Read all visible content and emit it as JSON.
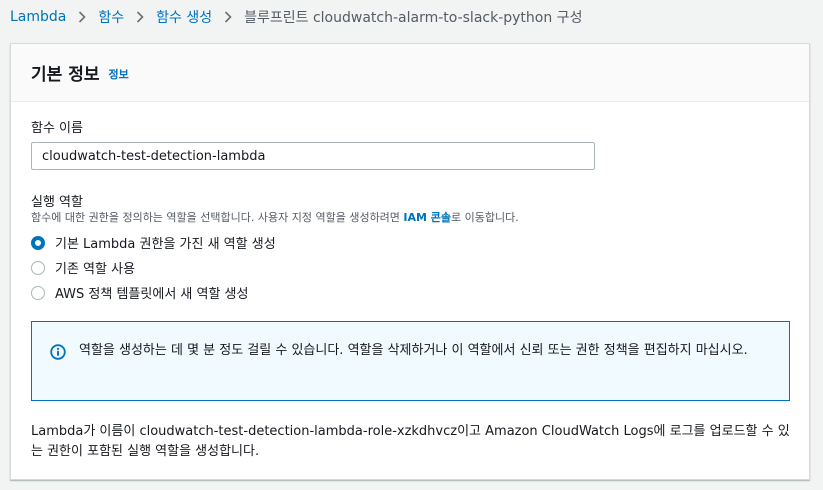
{
  "breadcrumb": {
    "items": [
      "Lambda",
      "함수",
      "함수 생성"
    ],
    "current": "블루프린트 cloudwatch-alarm-to-slack-python 구성"
  },
  "panel": {
    "title": "기본 정보",
    "info_link": "정보"
  },
  "function_name": {
    "label": "함수 이름",
    "value": "cloudwatch-test-detection-lambda"
  },
  "execution_role": {
    "label": "실행 역할",
    "description_before": "함수에 대한 권한을 정의하는 역할을 선택합니다. 사용자 지정 역할을 생성하려면 ",
    "description_link": "IAM 콘솔",
    "description_after": "로 이동합니다.",
    "options": [
      {
        "label": "기본 Lambda 권한을 가진 새 역할 생성",
        "selected": true
      },
      {
        "label": "기존 역할 사용",
        "selected": false
      },
      {
        "label": "AWS 정책 템플릿에서 새 역할 생성",
        "selected": false
      }
    ]
  },
  "alert": {
    "icon": "info-icon",
    "text": "역할을 생성하는 데 몇 분 정도 걸릴 수 있습니다. 역할을 삭제하거나 이 역할에서 신뢰 또는 권한 정책을 편집하지 마십시오."
  },
  "footer": {
    "text": "Lambda가 이름이 cloudwatch-test-detection-lambda-role-xzkdhvcz이고 Amazon CloudWatch Logs에 로그를 업로드할 수 있는 권한이 포함된 실행 역할을 생성합니다."
  },
  "colors": {
    "link": "#0073bb",
    "background": "#f2f3f3",
    "alert_bg": "#f1faff"
  }
}
